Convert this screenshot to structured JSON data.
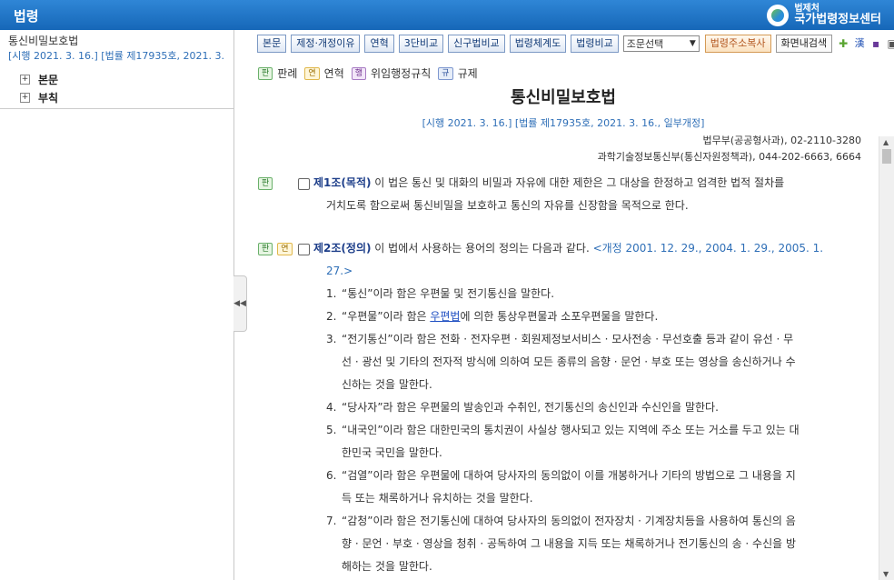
{
  "header": {
    "title": "법령",
    "logo_small": "법제처",
    "logo_big": "국가법령정보센터"
  },
  "sidebar": {
    "law_name": "통신비밀보호법",
    "law_date": "[시행 2021. 3. 16.] [법률 제17935호, 2021. 3.",
    "tree": [
      {
        "label": "본문"
      },
      {
        "label": "부칙"
      }
    ]
  },
  "toolbar": {
    "buttons": [
      "본문",
      "제정·개정이유",
      "연혁",
      "3단비교",
      "신구법비교",
      "법령체계도",
      "법령비교"
    ],
    "select_value": "조문선택",
    "copy_link": "법령주소복사",
    "screen_search": "화면내검색"
  },
  "legend": {
    "items": [
      {
        "badge": "판",
        "label": "판례"
      },
      {
        "badge": "연",
        "label": "연혁"
      },
      {
        "badge": "행",
        "label": "위임행정규칙"
      },
      {
        "badge": "규",
        "label": "규제"
      }
    ]
  },
  "document": {
    "title": "통신비밀보호법",
    "date": "[시행 2021. 3. 16.] [법률 제17935호, 2021. 3. 16., 일부개정]",
    "dept1": "법무부(공공형사과), 02-2110-3280",
    "dept2": "과학기술정보통신부(통신자원정책과), 044-202-6663, 6664"
  },
  "articles": {
    "a1": {
      "badge1": "판",
      "head": "제1조(목적)",
      "body": " 이 법은 통신 및 대화의 비밀과 자유에 대한 제한은 그 대상을 한정하고 엄격한 법적 절차를",
      "body2": "거치도록 함으로써 통신비밀을 보호하고 통신의 자유를 신장함을 목적으로 한다."
    },
    "a2": {
      "badge1": "판",
      "badge2": "연",
      "head": "제2조(정의)",
      "body": " 이 법에서 사용하는 용어의 정의는 다음과 같다. ",
      "amend": "<개정 2001. 12. 29., 2004. 1. 29., 2005. 1.",
      "amend2": "27.>",
      "items": {
        "i1": {
          "num": "1.",
          "text": "“통신”이라 함은 우편물 및 전기통신을 말한다."
        },
        "i2": {
          "num": "2.",
          "pre": "“우편물”이라 함은 ",
          "link": "우편법",
          "post": "에 의한 통상우편물과 소포우편물을 말한다."
        },
        "i3": {
          "num": "3.",
          "l1": "“전기통신”이라 함은 전화 · 전자우편 · 회원제정보서비스 · 모사전송 · 무선호출 등과 같이 유선 · 무",
          "l2": "선 · 광선 및 기타의 전자적 방식에 의하여 모든 종류의 음향 · 문언 · 부호 또는 영상을 송신하거나 수",
          "l3": "신하는 것을 말한다."
        },
        "i4": {
          "num": "4.",
          "text": "“당사자”라 함은 우편물의 발송인과 수취인, 전기통신의 송신인과 수신인을 말한다."
        },
        "i5": {
          "num": "5.",
          "l1": "“내국인”이라 함은 대한민국의 통치권이 사실상 행사되고 있는 지역에 주소 또는 거소를 두고 있는 대",
          "l2": "한민국 국민을 말한다."
        },
        "i6": {
          "num": "6.",
          "l1": "“검열”이라 함은 우편물에 대하여 당사자의 동의없이 이를 개봉하거나 기타의 방법으로 그 내용을 지",
          "l2": "득 또는 채록하거나 유치하는 것을 말한다."
        },
        "i7": {
          "num": "7.",
          "l1": "“감청”이라 함은 전기통신에 대하여 당사자의 동의없이 전자장치 · 기계장치등을 사용하여 통신의 음",
          "l2": "향 · 문언 · 부호 · 영상을 청취 · 공독하여 그 내용을 지득 또는 채록하거나 전기통신의 송 · 수신을 방",
          "l3": "해하는 것을 말한다."
        }
      }
    }
  },
  "colors": {
    "header_blue": "#1a6fc4",
    "link_blue": "#2f6fb7",
    "article_head": "#1e3f8a"
  }
}
